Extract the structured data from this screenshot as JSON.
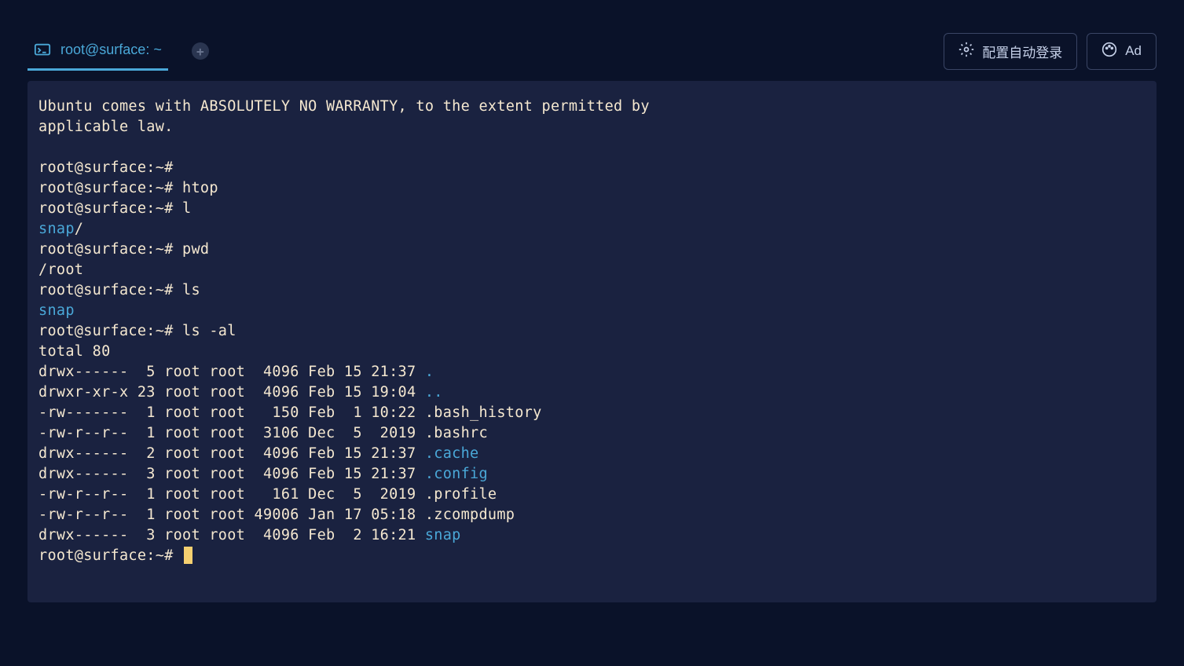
{
  "tab": {
    "title": "root@surface: ~"
  },
  "actions": {
    "auto_login": "配置自动登录",
    "ad": "Ad"
  },
  "terminal": {
    "motd_line1": "Ubuntu comes with ABSOLUTELY NO WARRANTY, to the extent permitted by",
    "motd_line2": "applicable law.",
    "prompt": "root@surface:~#",
    "cmd_htop": "htop",
    "cmd_l": "l",
    "out_snap_slash": "snap",
    "slash": "/",
    "cmd_pwd": "pwd",
    "out_root": "/root",
    "cmd_ls": "ls",
    "out_snap": "snap",
    "cmd_ls_al": "ls -al",
    "total": "total 80",
    "ls_rows": [
      {
        "meta": "drwx------  5 root root  4096 Feb 15 21:37 ",
        "name": ".",
        "dir": true
      },
      {
        "meta": "drwxr-xr-x 23 root root  4096 Feb 15 19:04 ",
        "name": "..",
        "dir": true
      },
      {
        "meta": "-rw-------  1 root root   150 Feb  1 10:22 ",
        "name": ".bash_history",
        "dir": false
      },
      {
        "meta": "-rw-r--r--  1 root root  3106 Dec  5  2019 ",
        "name": ".bashrc",
        "dir": false
      },
      {
        "meta": "drwx------  2 root root  4096 Feb 15 21:37 ",
        "name": ".cache",
        "dir": true
      },
      {
        "meta": "drwx------  3 root root  4096 Feb 15 21:37 ",
        "name": ".config",
        "dir": true
      },
      {
        "meta": "-rw-r--r--  1 root root   161 Dec  5  2019 ",
        "name": ".profile",
        "dir": false
      },
      {
        "meta": "-rw-r--r--  1 root root 49006 Jan 17 05:18 ",
        "name": ".zcompdump",
        "dir": false
      },
      {
        "meta": "drwx------  3 root root  4096 Feb  2 16:21 ",
        "name": "snap",
        "dir": true
      }
    ]
  }
}
